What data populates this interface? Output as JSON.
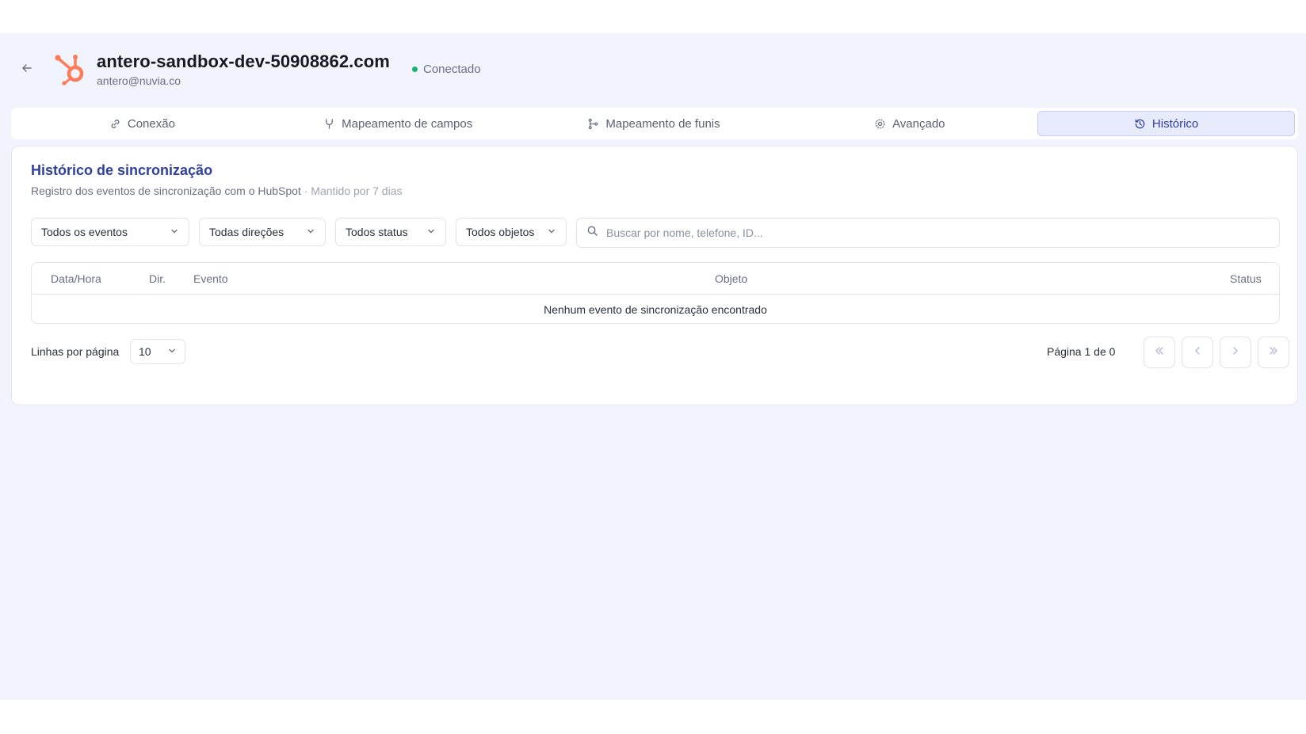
{
  "header": {
    "back_icon": "arrow-left-icon",
    "brand_icon": "hubspot-logo",
    "account_name": "antero-sandbox-dev-50908862.com",
    "account_email": "antero@nuvia.co",
    "status_label": "Conectado",
    "status_color": "#16b36a"
  },
  "tabs": [
    {
      "label": "Conexão",
      "icon": "link-icon",
      "active": false
    },
    {
      "label": "Mapeamento de campos",
      "icon": "fork-icon",
      "active": false
    },
    {
      "label": "Mapeamento de funis",
      "icon": "git-branch-icon",
      "active": false
    },
    {
      "label": "Avançado",
      "icon": "gear-icon",
      "active": false
    },
    {
      "label": "Histórico",
      "icon": "history-icon",
      "active": true
    }
  ],
  "card": {
    "title": "Histórico de sincronização",
    "subtitle": "Registro dos eventos de sincronização com o HubSpot",
    "retention": " · Mantido por 7 dias"
  },
  "filters": {
    "events": "Todos os eventos",
    "directions": "Todas direções",
    "status": "Todos status",
    "objects": "Todos objetos",
    "search_placeholder": "Buscar por nome, telefone, ID..."
  },
  "table": {
    "columns": [
      "Data/Hora",
      "Dir.",
      "Evento",
      "Objeto",
      "Status"
    ],
    "rows": [],
    "empty_message": "Nenhum evento de sincronização encontrado"
  },
  "pagination": {
    "rows_label": "Linhas por página",
    "rows_value": "10",
    "page_info": "Página 1 de 0"
  },
  "colors": {
    "accent": "#2f3fa0",
    "background": "#f1f4fd",
    "brand_orange": "#ff7a59"
  }
}
